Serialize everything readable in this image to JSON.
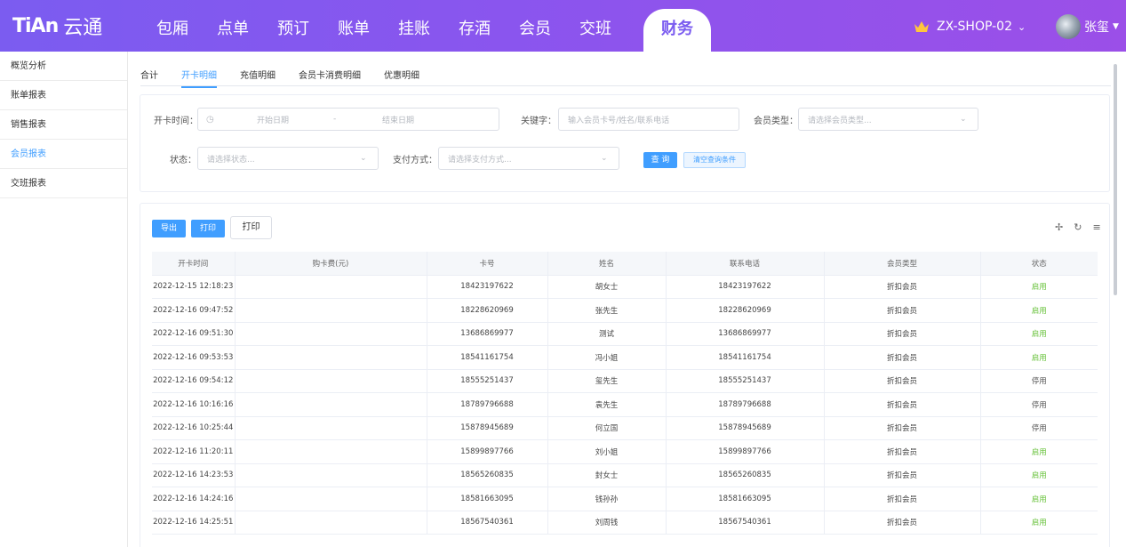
{
  "brand": {
    "logo_text": "TiAn",
    "name": "云通"
  },
  "nav": {
    "items": [
      "包厢",
      "点单",
      "预订",
      "账单",
      "挂账",
      "存酒",
      "会员",
      "交班"
    ],
    "active": "财务"
  },
  "shop": {
    "name": "ZX-SHOP-02",
    "icon": "crown-icon"
  },
  "user": {
    "name": "张玺"
  },
  "sidebar": {
    "items": [
      "概览分析",
      "账单报表",
      "销售报表",
      "会员报表",
      "交班报表"
    ],
    "active_index": 3
  },
  "tabs": {
    "items": [
      "合计",
      "开卡明细",
      "充值明细",
      "会员卡消费明细",
      "优惠明细"
    ],
    "active_index": 1
  },
  "filters": {
    "time_label": "开卡时间：",
    "start_placeholder": "开始日期",
    "range_sep": "-",
    "end_placeholder": "结束日期",
    "keyword_label": "关键字：",
    "keyword_placeholder": "输入会员卡号/姓名/联系电话",
    "member_type_label": "会员类型：",
    "member_type_placeholder": "请选择会员类型...",
    "status_label": "状态：",
    "status_placeholder": "请选择状态...",
    "pay_label": "支付方式：",
    "pay_placeholder": "请选择支付方式...",
    "query_label": "查 询",
    "clear_label": "清空查询条件"
  },
  "toolbar": {
    "export_label": "导出",
    "print_label": "打印",
    "print2_label": "打印"
  },
  "table": {
    "columns": [
      "开卡时间",
      "购卡费(元)",
      "卡号",
      "姓名",
      "联系电话",
      "会员类型",
      "状态"
    ],
    "rows": [
      [
        "2022-12-15 12:18:23",
        "",
        "18423197622",
        "胡女士",
        "18423197622",
        "折扣会员",
        "启用"
      ],
      [
        "2022-12-16 09:47:52",
        "",
        "18228620969",
        "张先生",
        "18228620969",
        "折扣会员",
        "启用"
      ],
      [
        "2022-12-16 09:51:30",
        "",
        "13686869977",
        "测试",
        "13686869977",
        "折扣会员",
        "启用"
      ],
      [
        "2022-12-16 09:53:53",
        "",
        "18541161754",
        "冯小姐",
        "18541161754",
        "折扣会员",
        "启用"
      ],
      [
        "2022-12-16 09:54:12",
        "",
        "18555251437",
        "玺先生",
        "18555251437",
        "折扣会员",
        "停用"
      ],
      [
        "2022-12-16 10:16:16",
        "",
        "18789796688",
        "袁先生",
        "18789796688",
        "折扣会员",
        "停用"
      ],
      [
        "2022-12-16 10:25:44",
        "",
        "15878945689",
        "何立国",
        "15878945689",
        "折扣会员",
        "停用"
      ],
      [
        "2022-12-16 11:20:11",
        "",
        "15899897766",
        "刘小姐",
        "15899897766",
        "折扣会员",
        "启用"
      ],
      [
        "2022-12-16 14:23:53",
        "",
        "18565260835",
        "封女士",
        "18565260835",
        "折扣会员",
        "启用"
      ],
      [
        "2022-12-16 14:24:16",
        "",
        "18581663095",
        "钱孙孙",
        "18581663095",
        "折扣会员",
        "启用"
      ],
      [
        "2022-12-16 14:25:51",
        "",
        "18567540361",
        "刘周钱",
        "18567540361",
        "折扣会员",
        "启用"
      ]
    ]
  },
  "colors": {
    "accent": "#409eff",
    "header_start": "#7b5cf0",
    "header_end": "#9b4fe8",
    "status_on": "#67c23a"
  }
}
